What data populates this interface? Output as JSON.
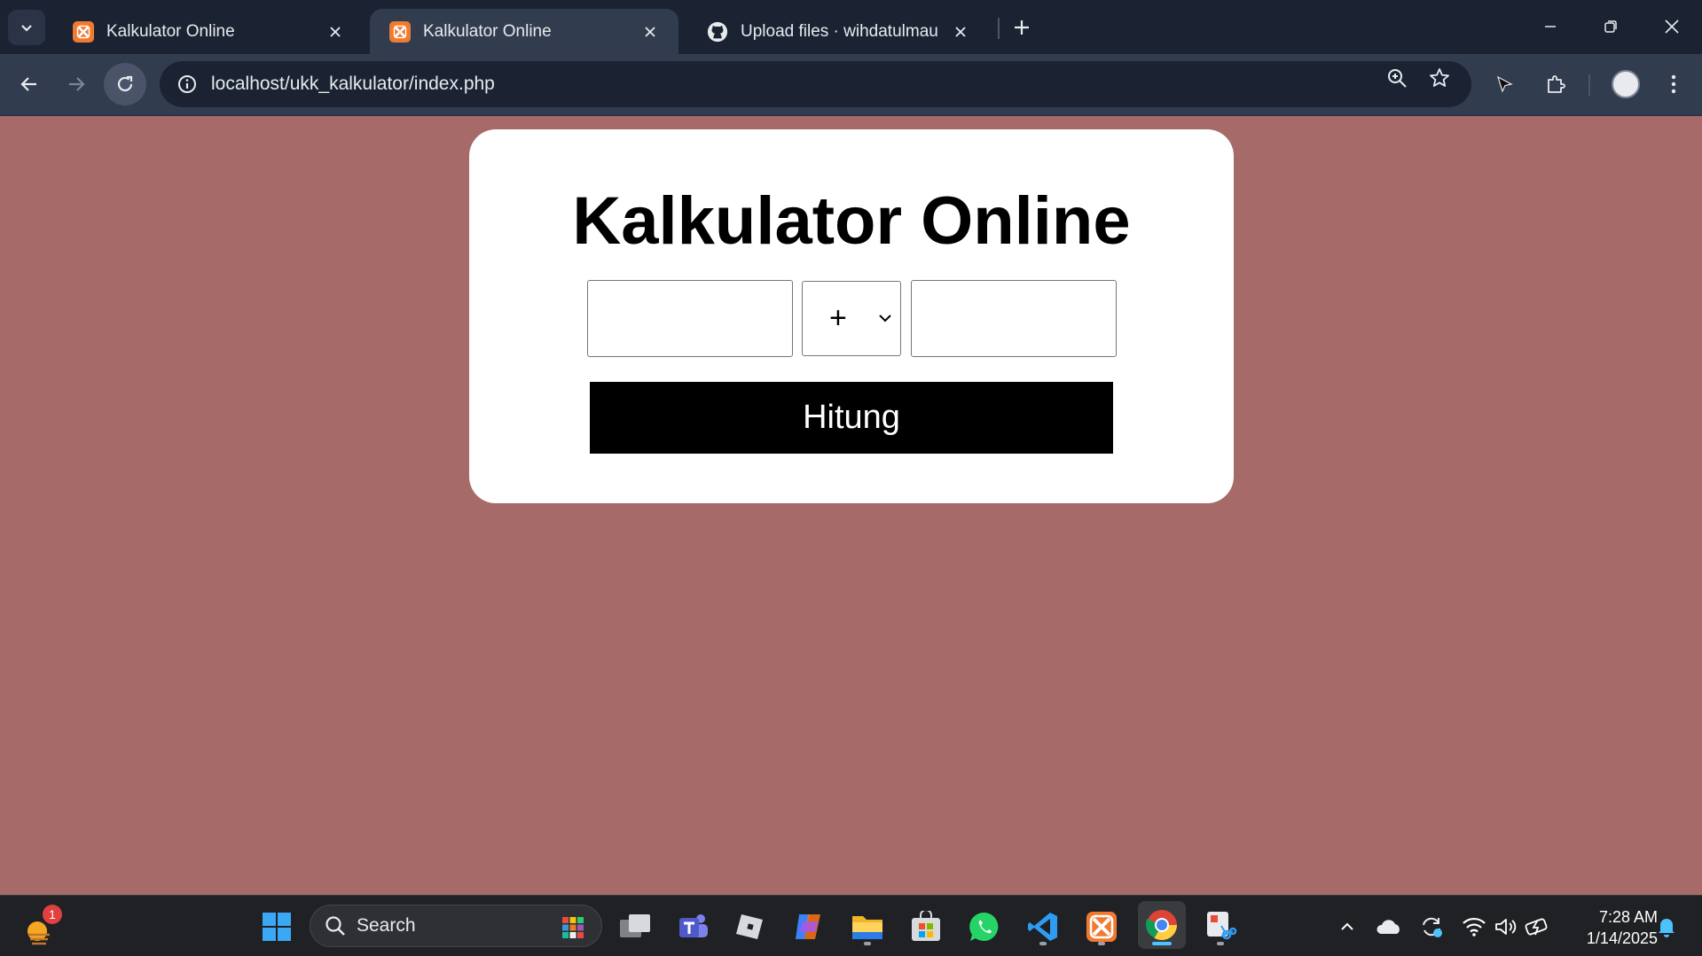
{
  "browser": {
    "tabs": [
      {
        "title": "Kalkulator Online",
        "favicon": "xampp-icon",
        "active": false
      },
      {
        "title": "Kalkulator Online",
        "favicon": "xampp-icon",
        "active": true
      },
      {
        "title": "Upload files · wihdatulmaulazuh",
        "favicon": "github-icon",
        "active": false
      }
    ],
    "url": "localhost/ukk_kalkulator/index.php"
  },
  "page": {
    "title": "Kalkulator Online",
    "first_number": {
      "value": "",
      "placeholder": ""
    },
    "operator": {
      "selected": "+"
    },
    "second_number": {
      "value": "",
      "placeholder": ""
    },
    "submit_label": "Hitung",
    "background_color": "#a66a69"
  },
  "taskbar": {
    "weather_badge": "1",
    "search_label": "Search",
    "apps": [
      "task-view-icon",
      "teams-icon",
      "roblox-icon",
      "copilot-icon",
      "file-explorer-icon",
      "microsoft-store-icon",
      "whatsapp-icon",
      "vscode-icon",
      "xampp-icon",
      "chrome-icon",
      "snipping-tool-icon"
    ],
    "clock": {
      "time": "7:28 AM",
      "date": "1/14/2025"
    }
  }
}
